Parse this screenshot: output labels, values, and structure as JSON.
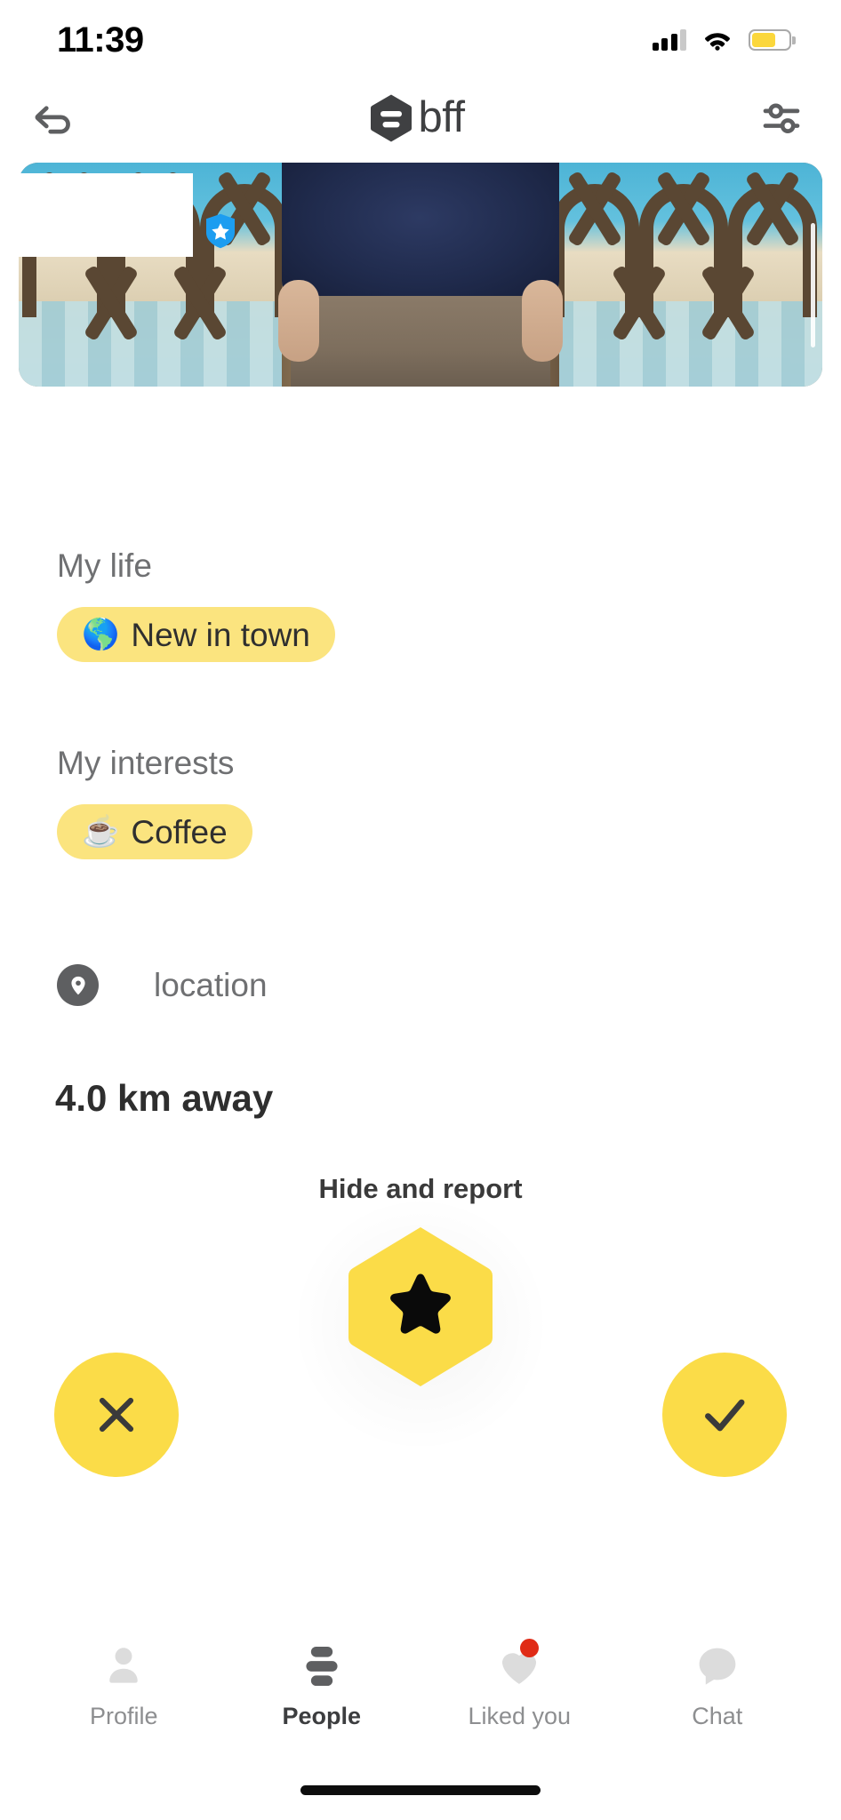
{
  "status_bar": {
    "time": "11:39",
    "signal_icon": "cellular-signal-icon",
    "wifi_icon": "wifi-icon",
    "battery_icon": "battery-low-power-icon",
    "battery_color": "#fbd73c"
  },
  "header": {
    "back_icon": "back-arrow-icon",
    "logo_icon": "bumble-hexagon-logo-icon",
    "title": "bff",
    "filter_icon": "filter-settings-icon"
  },
  "profile": {
    "photo_alt": "profile-photo",
    "name_redacted": true,
    "verified_badge_icon": "verified-shield-star-icon",
    "sections": [
      {
        "label": "My life",
        "tags": [
          {
            "emoji": "🌎",
            "text": "New in town"
          }
        ]
      },
      {
        "label": "My interests",
        "tags": [
          {
            "emoji": "☕",
            "text": "Coffee"
          }
        ]
      }
    ],
    "location": {
      "pin_icon": "location-pin-icon",
      "label": "location",
      "redacted_line": "",
      "distance": "4.0 km away"
    }
  },
  "actions": {
    "superswipe": {
      "icon": "star-icon",
      "name": "superswipe-button"
    },
    "dislike": {
      "icon": "close-x-icon",
      "name": "dislike-button"
    },
    "like": {
      "icon": "checkmark-icon",
      "name": "like-button"
    },
    "hide_and_report": "Hide and report",
    "accent_color": "#fbdc48"
  },
  "tabbar": {
    "items": [
      {
        "label": "Profile",
        "icon": "person-icon",
        "active": false,
        "badge": false
      },
      {
        "label": "People",
        "icon": "stacked-bars-icon",
        "active": true,
        "badge": false
      },
      {
        "label": "Liked you",
        "icon": "heart-icon",
        "active": false,
        "badge": true
      },
      {
        "label": "Chat",
        "icon": "speech-bubble-icon",
        "active": false,
        "badge": false
      }
    ]
  }
}
